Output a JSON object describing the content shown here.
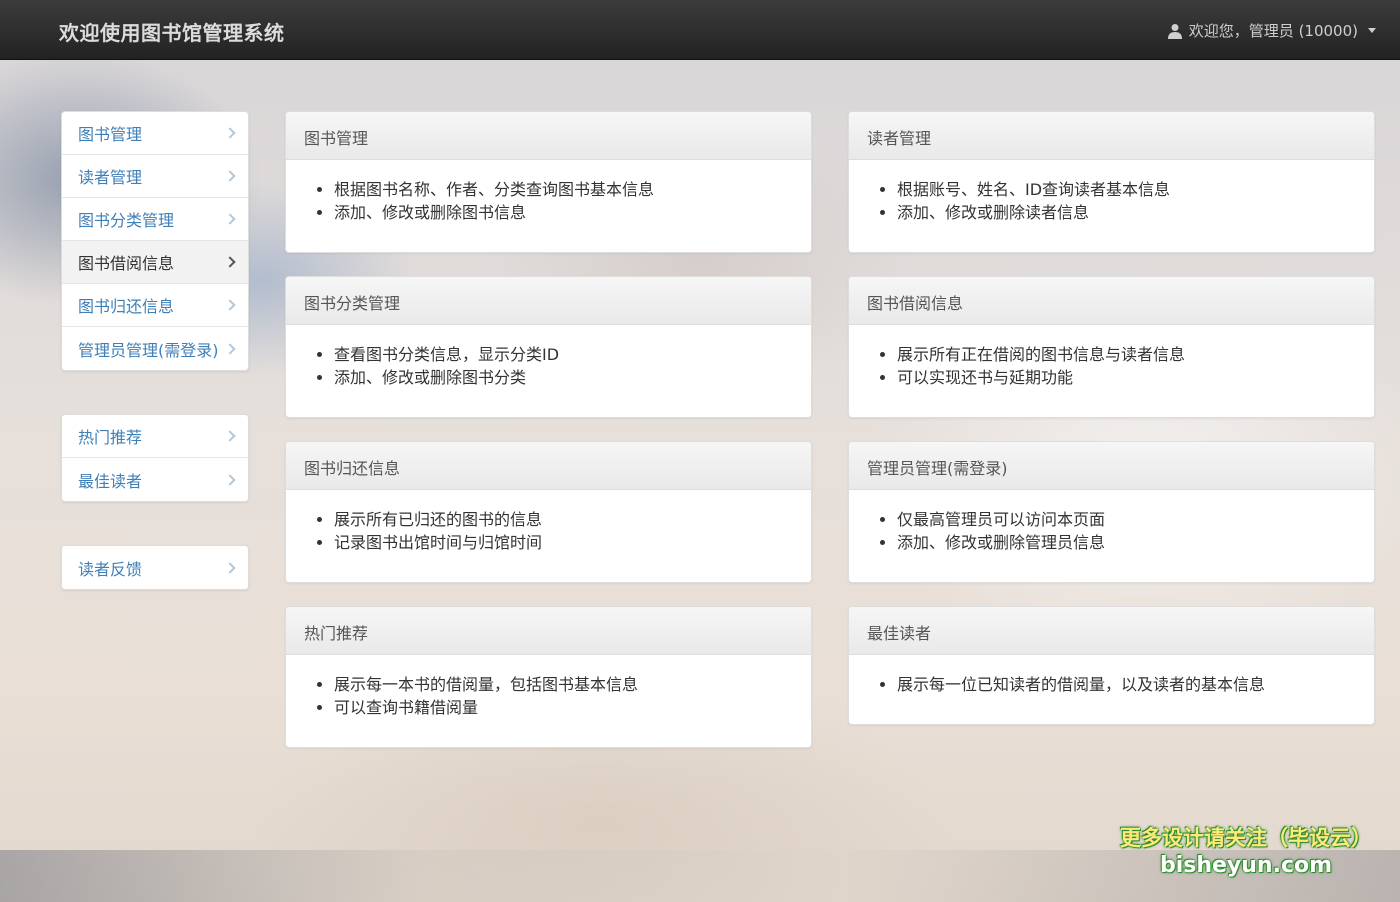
{
  "navbar": {
    "brand": "欢迎使用图书馆管理系统",
    "user_text": "欢迎您，管理员 (10000)",
    "user_icon": "user-icon"
  },
  "sidebar": {
    "group1": [
      {
        "label": "图书管理",
        "active": false
      },
      {
        "label": "读者管理",
        "active": false
      },
      {
        "label": "图书分类管理",
        "active": false
      },
      {
        "label": "图书借阅信息",
        "active": true
      },
      {
        "label": "图书归还信息",
        "active": false
      },
      {
        "label": "管理员管理(需登录)",
        "active": false
      }
    ],
    "group2": [
      {
        "label": "热门推荐"
      },
      {
        "label": "最佳读者"
      }
    ],
    "group3": [
      {
        "label": "读者反馈"
      }
    ]
  },
  "panels": [
    {
      "title": "图书管理",
      "items": [
        "根据图书名称、作者、分类查询图书基本信息",
        "添加、修改或删除图书信息"
      ]
    },
    {
      "title": "读者管理",
      "items": [
        "根据账号、姓名、ID查询读者基本信息",
        "添加、修改或删除读者信息"
      ]
    },
    {
      "title": "图书分类管理",
      "items": [
        "查看图书分类信息，显示分类ID",
        "添加、修改或删除图书分类"
      ]
    },
    {
      "title": "图书借阅信息",
      "items": [
        "展示所有正在借阅的图书信息与读者信息",
        "可以实现还书与延期功能"
      ]
    },
    {
      "title": "图书归还信息",
      "items": [
        "展示所有已归还的图书的信息",
        "记录图书出馆时间与归馆时间"
      ]
    },
    {
      "title": "管理员管理(需登录)",
      "items": [
        "仅最高管理员可以访问本页面",
        "添加、修改或删除管理员信息"
      ]
    },
    {
      "title": "热门推荐",
      "items": [
        "展示每一本书的借阅量，包括图书基本信息",
        "可以查询书籍借阅量"
      ]
    },
    {
      "title": "最佳读者",
      "items": [
        "展示每一位已知读者的借阅量，以及读者的基本信息"
      ]
    }
  ],
  "watermark": {
    "line1": "更多设计请关注（毕设云）",
    "line2": "bisheyun.com"
  }
}
